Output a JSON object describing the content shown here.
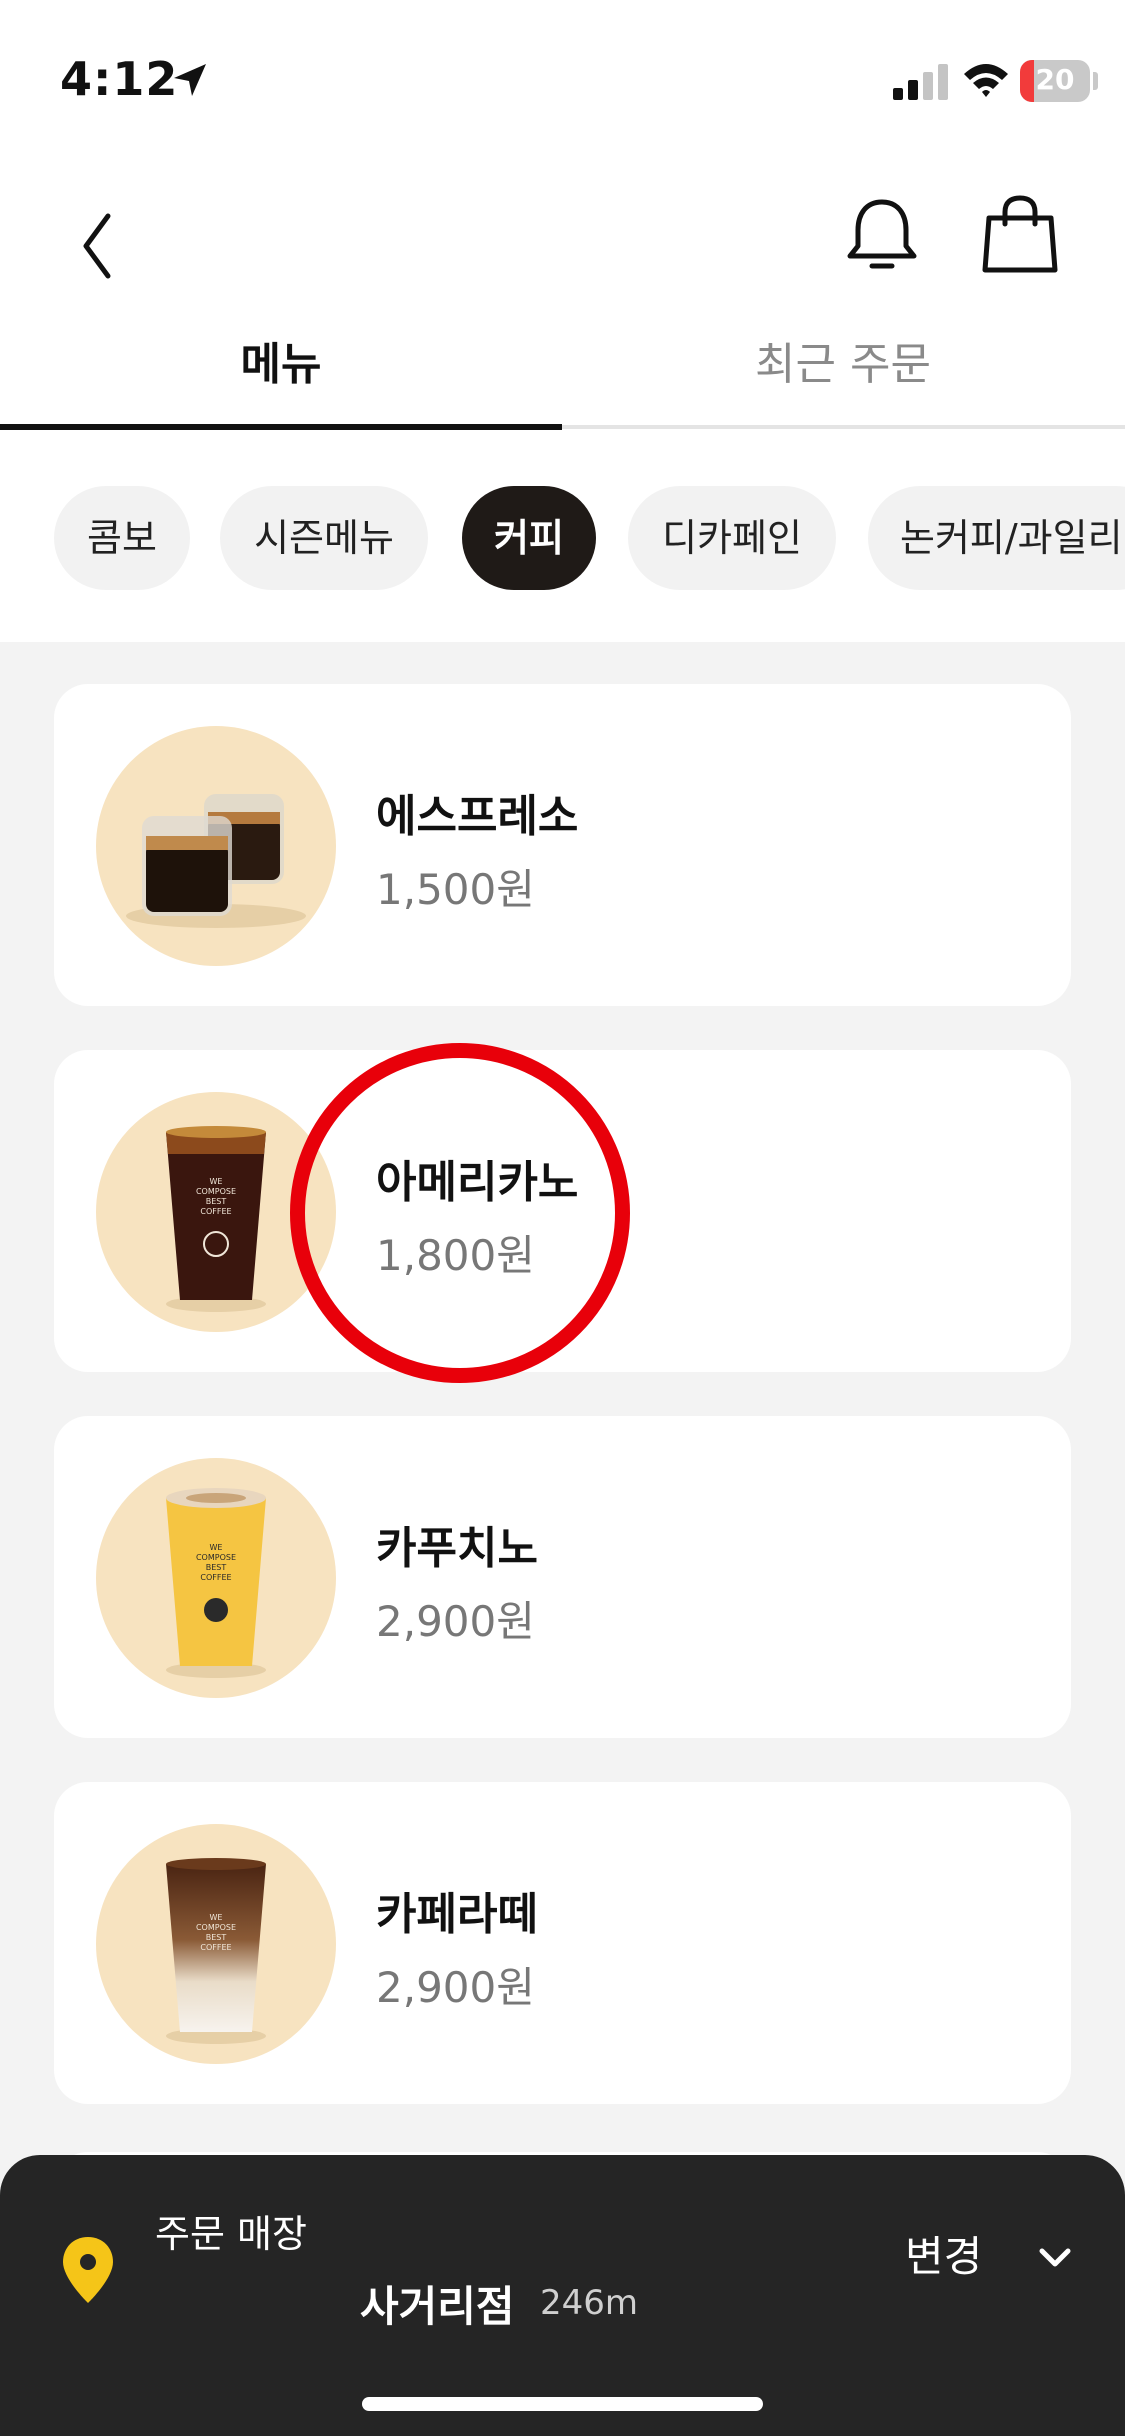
{
  "status_bar": {
    "time": "4:12",
    "battery": "20",
    "battery_level": 0.2
  },
  "header": {
    "back_icon": "chevron-left-icon",
    "notification_icon": "bell-icon",
    "cart_icon": "shopping-bag-icon"
  },
  "tabs": [
    {
      "label": "메뉴",
      "active": true
    },
    {
      "label": "최근 주문",
      "active": false
    }
  ],
  "categories": [
    {
      "label": "콤보",
      "selected": false
    },
    {
      "label": "시즌메뉴",
      "selected": false
    },
    {
      "label": "커피",
      "selected": true
    },
    {
      "label": "디카페인",
      "selected": false
    },
    {
      "label": "논커피/과일리",
      "selected": false
    }
  ],
  "menu_items": [
    {
      "name": "에스프레소",
      "price": "1,500원",
      "image": "espresso-glasses-image"
    },
    {
      "name": "아메리카노",
      "price": "1,800원",
      "image": "iced-americano-cup-image"
    },
    {
      "name": "카푸치노",
      "price": "2,900원",
      "image": "cappuccino-yellow-cup-image"
    },
    {
      "name": "카페라떼",
      "price": "2,900원",
      "image": "iced-latte-cup-image"
    }
  ],
  "cup_text": {
    "line1": "WE",
    "line2": "COMPOSE",
    "line3": "BEST",
    "line4": "COFFEE"
  },
  "store": {
    "label": "주문 매장",
    "name": "사거리점",
    "distance": "246m",
    "change_label": "변경",
    "pin_icon": "location-pin-icon",
    "chevron_icon": "chevron-down-icon"
  },
  "colors": {
    "selected_chip": "#1f1a17",
    "thumb_bg": "#f7e3c0",
    "store_bar": "#252525",
    "pin": "#f5c518",
    "annotation": "#e8000a"
  }
}
